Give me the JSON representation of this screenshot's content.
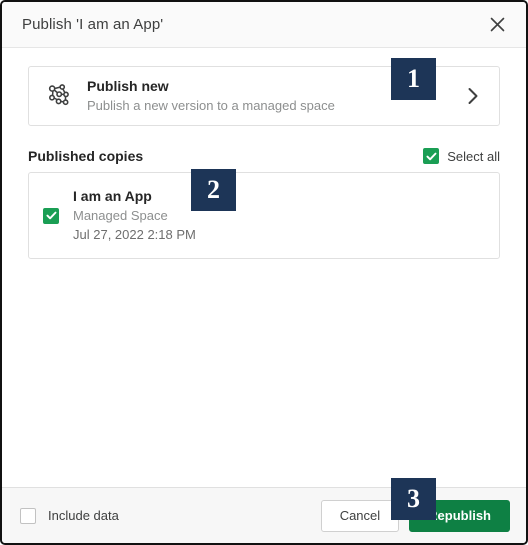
{
  "dialog": {
    "title": "Publish 'I am an App'",
    "close_icon": "close-icon"
  },
  "publish_new": {
    "icon": "network-graph-icon",
    "title": "Publish new",
    "subtitle": "Publish a new version to a managed space",
    "chevron_icon": "chevron-right-icon"
  },
  "published_copies": {
    "label": "Published copies",
    "select_all": {
      "label": "Select all",
      "checked": true
    },
    "items": [
      {
        "name": "I am an App",
        "space": "Managed Space",
        "date": "Jul 27, 2022 2:18 PM",
        "checked": true
      }
    ]
  },
  "footer": {
    "include_data": {
      "label": "Include data",
      "checked": false
    },
    "cancel_label": "Cancel",
    "republish_label": "Republish"
  },
  "annotations": [
    {
      "label": "1"
    },
    {
      "label": "2"
    },
    {
      "label": "3"
    }
  ],
  "colors": {
    "accent_green": "#0e8044",
    "checkbox_green": "#1a9e54",
    "badge_navy": "#1d3557",
    "border": "#e0e0e0",
    "text_primary": "#262626",
    "text_muted": "#8d8f8f"
  }
}
